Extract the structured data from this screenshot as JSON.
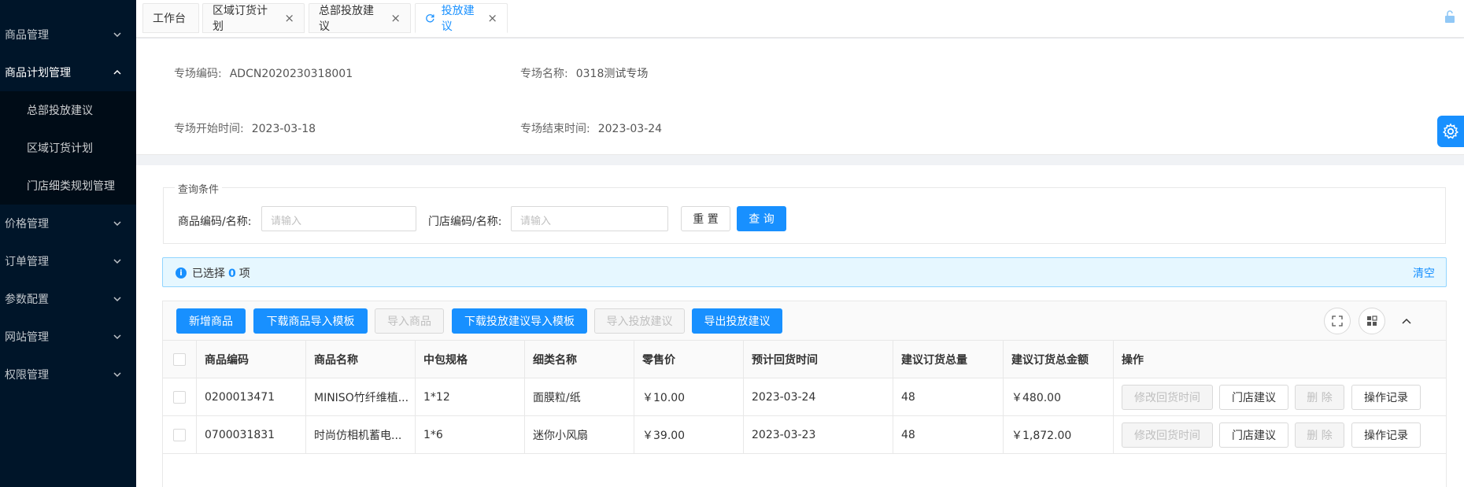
{
  "sidebar": {
    "items": [
      {
        "label": "商品管理"
      },
      {
        "label": "商品计划管理"
      },
      {
        "label": "价格管理"
      },
      {
        "label": "订单管理"
      },
      {
        "label": "参数配置"
      },
      {
        "label": "网站管理"
      },
      {
        "label": "权限管理"
      }
    ],
    "subitems": [
      {
        "label": "总部投放建议"
      },
      {
        "label": "区域订货计划"
      },
      {
        "label": "门店细类规划管理"
      }
    ]
  },
  "tabs": [
    {
      "label": "工作台"
    },
    {
      "label": "区域订货计划"
    },
    {
      "label": "总部投放建议"
    },
    {
      "label": "投放建议"
    }
  ],
  "info": {
    "code_label": "专场编码:",
    "code_value": "ADCN2020230318001",
    "name_label": "专场名称:",
    "name_value": "0318测试专场",
    "start_label": "专场开始时间:",
    "start_value": "2023-03-18",
    "end_label": "专场结束时间:",
    "end_value": "2023-03-24"
  },
  "query": {
    "legend": "查询条件",
    "product_label": "商品编码/名称:",
    "product_placeholder": "请输入",
    "store_label": "门店编码/名称:",
    "store_placeholder": "请输入",
    "reset": "重 置",
    "search": "查 询"
  },
  "selection": {
    "prefix": "已选择",
    "count": "0",
    "suffix": "项",
    "clear": "清空"
  },
  "toolbar": {
    "add": "新增商品",
    "download_product_tpl": "下载商品导入模板",
    "import_product": "导入商品",
    "download_advice_tpl": "下载投放建议导入模板",
    "import_advice": "导入投放建议",
    "export_advice": "导出投放建议"
  },
  "table": {
    "headers": [
      "商品编码",
      "商品名称",
      "中包规格",
      "细类名称",
      "零售价",
      "预计回货时间",
      "建议订货总量",
      "建议订货总金额",
      "操作"
    ],
    "rows": [
      [
        "0200013471",
        "MINISO竹纤维植...",
        "1*12",
        "面膜粒/纸",
        "￥10.00",
        "2023-03-24",
        "48",
        "￥480.00"
      ],
      [
        "0700031831",
        "时尚仿相机蓄电...",
        "1*6",
        "迷你小风扇",
        "￥39.00",
        "2023-03-23",
        "48",
        "￥1,872.00"
      ]
    ],
    "actions": {
      "modify_time": "修改回货时间",
      "store_advice": "门店建议",
      "delete": "删 除",
      "log": "操作记录"
    }
  },
  "colors": {
    "primary": "#1890ff",
    "sidebar_bg": "#001529"
  }
}
